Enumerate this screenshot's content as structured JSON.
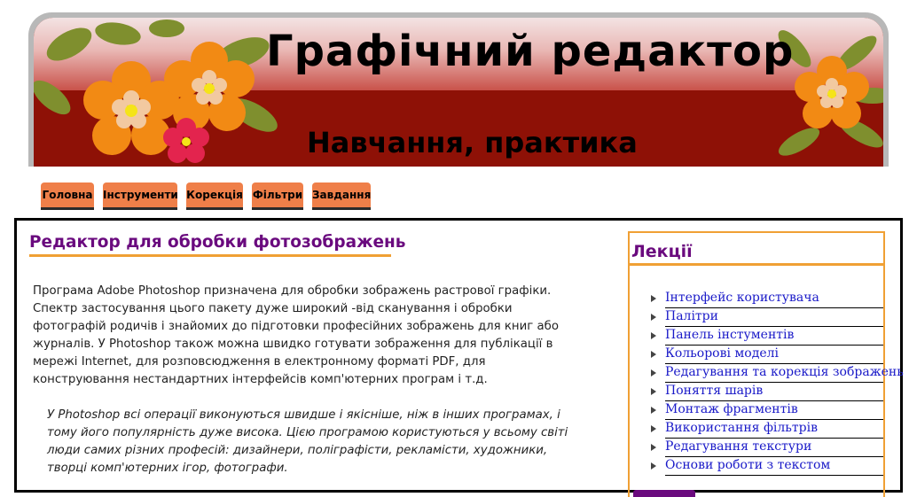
{
  "header": {
    "title": "Графічний редактор",
    "subtitle": "Навчання, практика"
  },
  "nav": {
    "tabs": [
      {
        "label": "Головна"
      },
      {
        "label": "Інструменти"
      },
      {
        "label": "Корекція"
      },
      {
        "label": "Фільтри"
      },
      {
        "label": "Завдання"
      }
    ]
  },
  "article": {
    "title": "Редактор для обробки фотозображень",
    "paragraph": "Програма Adobe Photoshop призначена для обробки зображень растрової графіки. Спектр застосування цього пакету дуже широкий -від сканування і обробки фотографій родичів і знайомих до підготовки професійних зображень для книг або журналів. У Photoshop також можна швидко готувати зображення для публікації в мережі Internet, для розповсюдження в електронному форматі PDF, для конструювання нестандартних інтерфейсів комп'ютерних програм і т.д.",
    "quote": "У Photoshop всі операції виконуються швидше і якісніше, ніж в інших програмах, і тому його популярність дуже висока. Цією програмою користуються у всьому світі люди самих різних професій: дизайнери, поліграфісти, рекламісти, художники, творці комп'ютерних ігор, фотографи."
  },
  "sidebar": {
    "title": "Лекції",
    "items": [
      {
        "label": "Інтерфейс користувача"
      },
      {
        "label": "Палітри"
      },
      {
        "label": "Панель інстументів"
      },
      {
        "label": "Кольорові моделі"
      },
      {
        "label": "Редагування та корекція зображень"
      },
      {
        "label": "Поняття шарів"
      },
      {
        "label": "Монтаж фрагментів"
      },
      {
        "label": "Використання фільтрів"
      },
      {
        "label": "Редагування текстури"
      },
      {
        "label": "Основи роботи з текстом"
      }
    ]
  },
  "colors": {
    "banner_red": "#8e1106",
    "tab_orange": "#ef7f49",
    "heading_purple": "#6a0a7e",
    "accent_orange": "#f0a034",
    "link_blue": "#1919c8"
  }
}
